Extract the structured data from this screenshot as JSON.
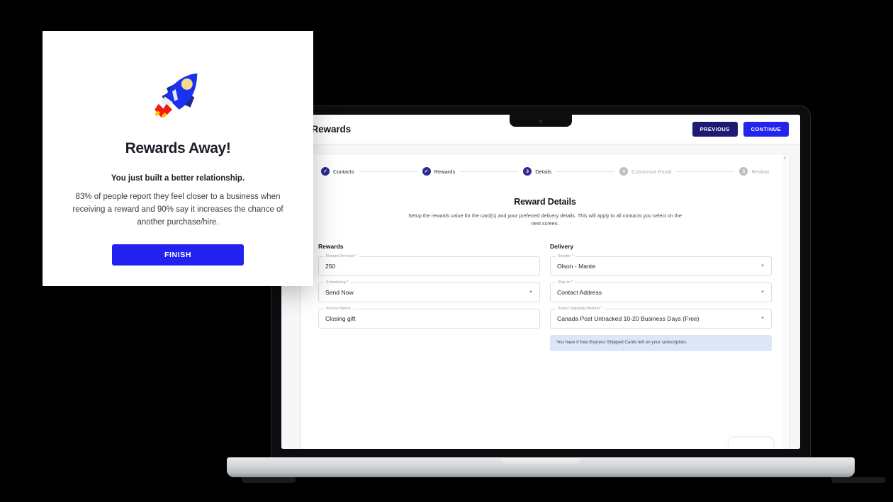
{
  "modal": {
    "icon": "rocket-icon",
    "title": "Rewards Away!",
    "subtitle": "You just built a better relationship.",
    "body": "83% of people report they feel closer to a business when receiving a reward and 90% say it increases the chance of another purchase/hire.",
    "finish_label": "FINISH",
    "finish_color": "#2222f0"
  },
  "app": {
    "title": "Gift Rewards",
    "previous_label": "PREVIOUS",
    "continue_label": "CONTINUE",
    "previous_color": "#1f1b73",
    "continue_color": "#2424ef",
    "stepper": [
      {
        "num": "✓",
        "label": "Contacts",
        "state": "done"
      },
      {
        "num": "✓",
        "label": "Rewards",
        "state": "done"
      },
      {
        "num": "3",
        "label": "Details",
        "state": "active"
      },
      {
        "num": "4",
        "label": "Customize Email",
        "state": "todo"
      },
      {
        "num": "5",
        "label": "Review",
        "state": "todo"
      }
    ],
    "heading": "Reward Details",
    "description": "Setup the rewards value for the card(s) and your preferred delivery details. This will apply to all contacts you select on the next screen.",
    "rewards_column": {
      "title": "Rewards",
      "fields": [
        {
          "label": "Reward Amount *",
          "value": "250",
          "type": "text"
        },
        {
          "label": "Scheduling *",
          "value": "Send Now",
          "type": "select"
        },
        {
          "label": "Invoice Memo",
          "value": "Closing gift",
          "type": "text"
        }
      ]
    },
    "delivery_column": {
      "title": "Delivery",
      "fields": [
        {
          "label": "Sender *",
          "value": "Olson - Mante",
          "type": "select"
        },
        {
          "label": "Ship to *",
          "value": "Contact Address",
          "type": "select"
        },
        {
          "label": "Select Shipping Method *",
          "value": "Canada Post Untracked 10-20 Business Days (Free)",
          "type": "select"
        }
      ],
      "notice": "You have 0 free Express Shipped Cards left on your subscription.",
      "notice_color": "#dce6f7"
    },
    "scroll_up_glyph": "▲"
  }
}
